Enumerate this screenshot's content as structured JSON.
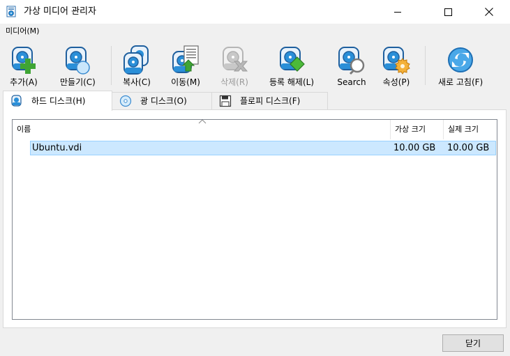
{
  "window": {
    "title": "가상 미디어 관리자"
  },
  "menu": {
    "items": [
      "미디어(M)"
    ]
  },
  "toolbar": {
    "buttons": [
      {
        "label": "추가(A)",
        "icon": "disk-add-icon",
        "enabled": true
      },
      {
        "label": "만들기(C)",
        "icon": "disk-create-icon",
        "enabled": true
      },
      {
        "label": "복사(C)",
        "icon": "disk-copy-icon",
        "enabled": true
      },
      {
        "label": "이동(M)",
        "icon": "disk-move-icon",
        "enabled": true
      },
      {
        "label": "삭제(R)",
        "icon": "disk-remove-icon",
        "enabled": false
      },
      {
        "label": "등록 해제(L)",
        "icon": "disk-release-icon",
        "enabled": true
      },
      {
        "label": "Search",
        "icon": "disk-search-icon",
        "enabled": true
      },
      {
        "label": "속성(P)",
        "icon": "disk-properties-icon",
        "enabled": true
      },
      {
        "label": "새로 고침(F)",
        "icon": "refresh-icon",
        "enabled": true
      }
    ]
  },
  "tabs": [
    {
      "label": "하드 디스크(H)",
      "icon": "hard-disk-icon",
      "active": true
    },
    {
      "label": "광 디스크(O)",
      "icon": "optical-disk-icon",
      "active": false
    },
    {
      "label": "플로피 디스크(F)",
      "icon": "floppy-disk-icon",
      "active": false
    }
  ],
  "table": {
    "columns": [
      "이름",
      "가상 크기",
      "실제 크기"
    ],
    "rows": [
      {
        "name": "Ubuntu.vdi",
        "virtual_size": "10.00 GB",
        "actual_size": "10.00 GB",
        "selected": true
      }
    ]
  },
  "footer": {
    "close_label": "닫기"
  },
  "colors": {
    "selection": "#cce8ff",
    "selection_border": "#99d1ff",
    "accent_blue": "#1e73be",
    "add_green": "#3fa535"
  }
}
